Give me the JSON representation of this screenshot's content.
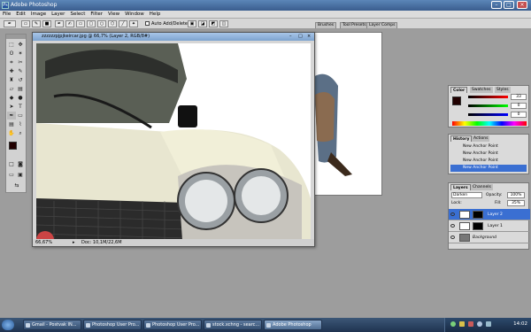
{
  "app": {
    "title": "Adobe Photoshop"
  },
  "menu": [
    "File",
    "Edit",
    "Image",
    "Layer",
    "Select",
    "Filter",
    "View",
    "Window",
    "Help"
  ],
  "options": {
    "auto_add_delete_label": "Auto Add/Delete"
  },
  "palette_well": {
    "tabs": [
      "Brushes",
      "Tool Presets",
      "Layer Comps"
    ]
  },
  "document": {
    "title": "zzzzzzpjpjkeircar.jpg @ 66,7% (Layer 2, RGB/8#)",
    "zoom": "66,67%",
    "doc_info": "Doc: 10,1M/22,6M"
  },
  "color_palette": {
    "tabs": [
      "Color",
      "Swatches",
      "Styles"
    ],
    "r": "33",
    "g": "0",
    "b": "0",
    "colors": {
      "fg": "#210000",
      "bg": "#ffffff"
    }
  },
  "history_palette": {
    "tabs": [
      "History",
      "Actions"
    ],
    "items": [
      "New Anchor Point",
      "New Anchor Point",
      "New Anchor Point",
      "New Anchor Point"
    ]
  },
  "layers_palette": {
    "tabs": [
      "Layers",
      "Channels"
    ],
    "blend_mode": "Darken",
    "opacity_label": "Opacity:",
    "opacity": "100%",
    "lock_label": "Lock:",
    "fill_label": "Fill:",
    "fill": "35%",
    "layers": [
      "Layer 2",
      "Layer 1",
      "Background"
    ]
  },
  "taskbar": {
    "tasks": [
      "Gmail - Postvak IN...",
      "Photoshop User Pro...",
      "Photoshop User Pro...",
      "stock.xchng - searc...",
      "Adobe Photoshop"
    ],
    "clock": "14:02"
  }
}
